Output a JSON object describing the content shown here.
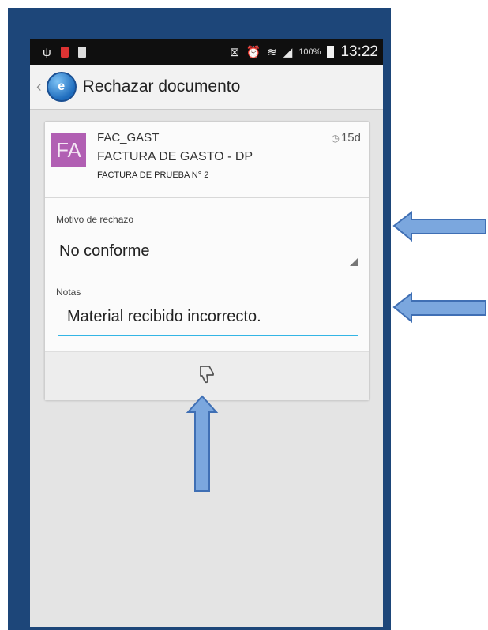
{
  "status_bar": {
    "usb_icon": "ψ",
    "battery_percent": "100%",
    "time": "13:22"
  },
  "action_bar": {
    "back_icon": "‹",
    "app_icon": "e",
    "title": "Rechazar documento"
  },
  "document": {
    "avatar_text": "FA",
    "code": "FAC_GAST",
    "type": "FACTURA DE GASTO - DP",
    "description": "FACTURA DE PRUEBA N° 2",
    "age": "15d"
  },
  "form": {
    "reason_label": "Motivo de rechazo",
    "reason_value": "No conforme",
    "notes_label": "Notas",
    "notes_value": "Material recibido incorrecto."
  },
  "actions": {
    "reject_icon": "thumbs-down-icon"
  },
  "colors": {
    "frame": "#1d4679",
    "avatar": "#b15fb3",
    "focus_line": "#33b5e5",
    "arrow_fill": "#7ba7de"
  }
}
